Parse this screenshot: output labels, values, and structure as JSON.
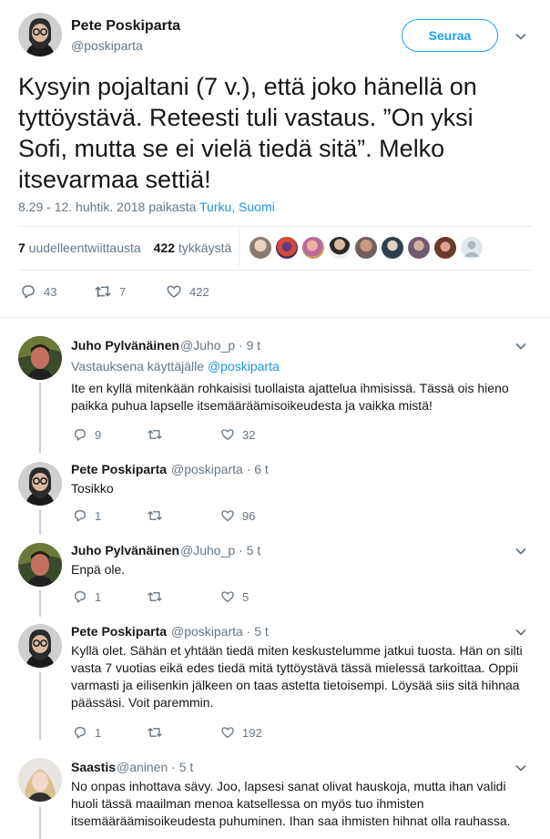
{
  "main_tweet": {
    "author_name": "Pete Poskiparta",
    "author_handle": "@poskiparta",
    "follow_label": "Seuraa",
    "text": "Kysyin pojaltani (7 v.), että joko hänellä on tyttöystävä. Reteesti tuli vastaus. ”On yksi Sofi, mutta se ei vielä tiedä sitä”. Melko itsevarmaa settiä!",
    "timestamp": "8.29 - 12. huhtik. 2018 paikasta ",
    "location": "Turku, Suomi",
    "retweet_count": "7",
    "retweet_label": " uudelleentwiittausta",
    "like_count": "422",
    "like_label": " tykkäystä",
    "actions": {
      "reply": "43",
      "retweet": "7",
      "like": "422"
    }
  },
  "replies": [
    {
      "name": "Juho Pylvänäinen",
      "handle": "@Juho_p · 9 t",
      "reply_to_prefix": "Vastauksena käyttäjälle ",
      "reply_to_handle": "@poskiparta",
      "text": "Ite en kyllä mitenkään rohkaisisi tuollaista ajattelua ihmisissä. Tässä ois hieno paikka puhua lapselle itsemääräämisoikeudesta ja vaikka mistä!",
      "replies": "9",
      "retweets": "",
      "likes": "32"
    },
    {
      "name": "Pete Poskiparta",
      "handle": "@poskiparta · 6 t",
      "text": "Tosikko",
      "replies": "1",
      "retweets": "",
      "likes": "96"
    },
    {
      "name": "Juho Pylvänäinen",
      "handle": "@Juho_p · 5 t",
      "text": "Enpä ole.",
      "replies": "1",
      "retweets": "",
      "likes": "5"
    },
    {
      "name": "Pete Poskiparta",
      "handle": "@poskiparta · 5 t",
      "text": "Kyllä olet. Sähän et yhtään tiedä miten keskustelumme jatkui tuosta. Hän on silti vasta 7 vuotias eikä edes tiedä mitä tyttöystävä tässä mielessä tarkoittaa. Oppii varmasti ja eilisenkin jälkeen on taas astetta tietoisempi. Löysää siis sitä hihnaa päässäsi. Voit paremmin.",
      "replies": "1",
      "retweets": "",
      "likes": "192"
    },
    {
      "name": "Saastis",
      "handle": "@aninen · 5 t",
      "text": "No onpas inhottava sävy. Joo, lapsesi sanat olivat hauskoja, mutta ihan validi huoli tässä maailman menoa katsellessa on myös tuo ihmisten itsemääräämisoikeudesta puhuminen. Ihan saa ihmisten hihnat olla rauhassa."
    }
  ],
  "colors": {
    "link": "#1b95e0",
    "follow_blue": "#1da1f2",
    "muted": "#657786",
    "divider": "#e6ecf0",
    "thread_line": "#c4cfd6"
  },
  "icons": [
    "reply-icon",
    "retweet-icon",
    "like-icon",
    "chevron-down-icon"
  ]
}
